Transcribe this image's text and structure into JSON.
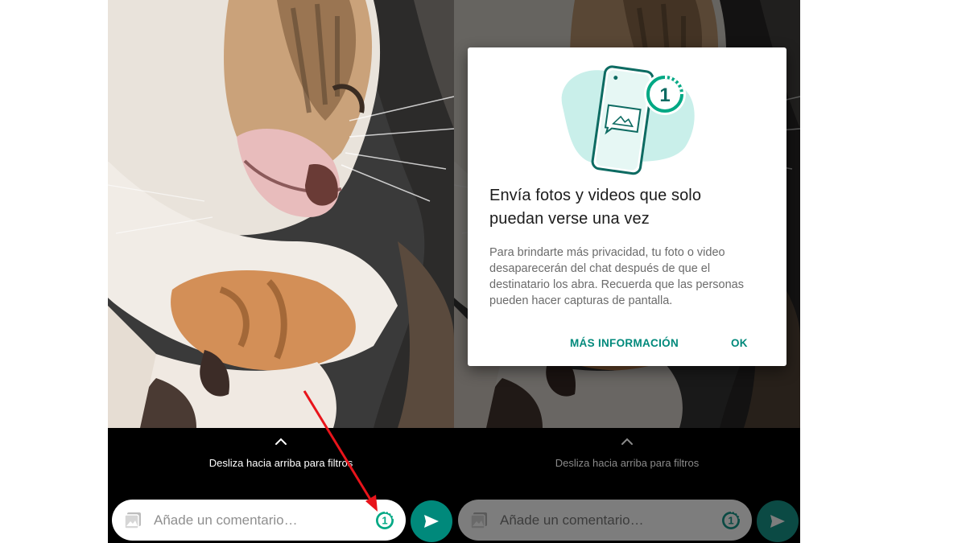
{
  "left_screen": {
    "filter_hint": "Desliza hacia arriba para filtros",
    "comment_placeholder": "Añade un comentario…",
    "view_once_count": "1"
  },
  "right_screen": {
    "filter_hint": "Desliza hacia arriba para filtros",
    "comment_placeholder": "Añade un comentario…",
    "view_once_count": "1"
  },
  "dialog": {
    "badge_count": "1",
    "title": "Envía fotos y videos que solo puedan verse una vez",
    "body": "Para brindarte más privacidad, tu foto o video desaparecerán del chat después de que el destinatario los abra. Recuerda que las personas pueden hacer capturas de pantalla.",
    "more_info_label": "MÁS INFORMACIÓN",
    "ok_label": "OK"
  },
  "colors": {
    "accent": "#00897b",
    "illustration_blob": "#c9efea",
    "annotation_arrow": "#e8141b"
  }
}
